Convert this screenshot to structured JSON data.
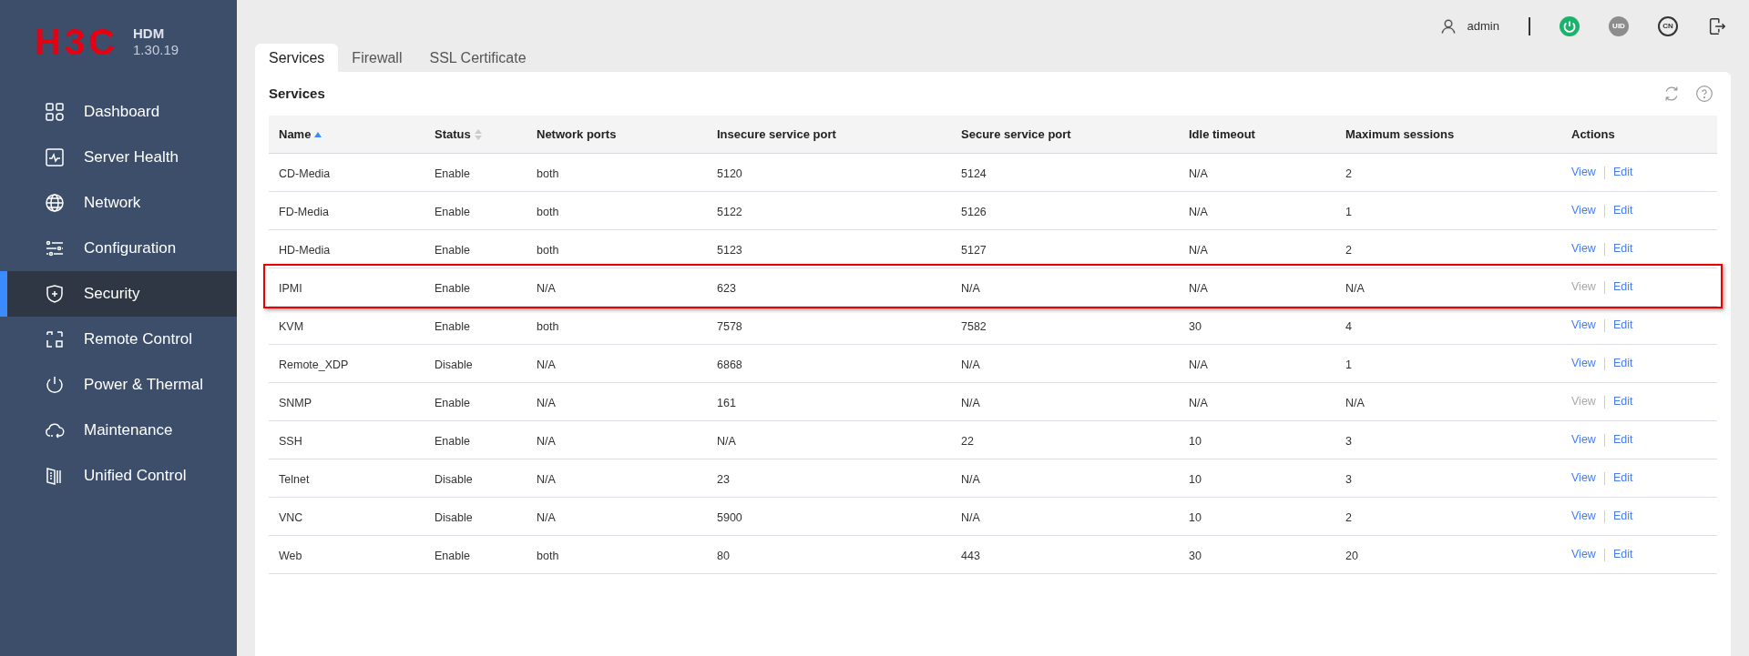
{
  "brand": {
    "logo": "H3C",
    "product": "HDM",
    "version": "1.30.19"
  },
  "sidebar": {
    "items": [
      {
        "label": "Dashboard",
        "kind": "grid",
        "selected": false
      },
      {
        "label": "Server Health",
        "kind": "pulse",
        "selected": false
      },
      {
        "label": "Network",
        "kind": "globe",
        "selected": false
      },
      {
        "label": "Configuration",
        "kind": "sliders",
        "selected": false
      },
      {
        "label": "Security",
        "kind": "shield",
        "selected": true
      },
      {
        "label": "Remote Control",
        "kind": "remote",
        "selected": false
      },
      {
        "label": "Power & Thermal",
        "kind": "power",
        "selected": false
      },
      {
        "label": "Maintenance",
        "kind": "cloud",
        "selected": false
      },
      {
        "label": "Unified Control",
        "kind": "panel",
        "selected": false
      }
    ]
  },
  "header": {
    "user": "admin",
    "uid": "UID",
    "language": "CN"
  },
  "tabs": [
    {
      "label": "Services",
      "selected": true
    },
    {
      "label": "Firewall",
      "selected": false
    },
    {
      "label": "SSL Certificate",
      "selected": false
    }
  ],
  "panel": {
    "title": "Services"
  },
  "table": {
    "columns": [
      {
        "label": "Name",
        "sorted": true
      },
      {
        "label": "Status",
        "sorted": false
      },
      {
        "label": "Network ports"
      },
      {
        "label": "Insecure service port"
      },
      {
        "label": "Secure service port"
      },
      {
        "label": "Idle timeout"
      },
      {
        "label": "Maximum sessions"
      },
      {
        "label": "Actions"
      }
    ],
    "rows": [
      {
        "cells": [
          "CD-Media",
          "Enable",
          "both",
          "5120",
          "5124",
          "N/A",
          "2"
        ],
        "view": "View",
        "edit": "Edit",
        "view_disabled": false,
        "highlighted": false
      },
      {
        "cells": [
          "FD-Media",
          "Enable",
          "both",
          "5122",
          "5126",
          "N/A",
          "1"
        ],
        "view": "View",
        "edit": "Edit",
        "view_disabled": false,
        "highlighted": false
      },
      {
        "cells": [
          "HD-Media",
          "Enable",
          "both",
          "5123",
          "5127",
          "N/A",
          "2"
        ],
        "view": "View",
        "edit": "Edit",
        "view_disabled": false,
        "highlighted": false
      },
      {
        "cells": [
          "IPMI",
          "Enable",
          "N/A",
          "623",
          "N/A",
          "N/A",
          "N/A"
        ],
        "view": "View",
        "edit": "Edit",
        "view_disabled": true,
        "highlighted": true
      },
      {
        "cells": [
          "KVM",
          "Enable",
          "both",
          "7578",
          "7582",
          "30",
          "4"
        ],
        "view": "View",
        "edit": "Edit",
        "view_disabled": false,
        "highlighted": false
      },
      {
        "cells": [
          "Remote_XDP",
          "Disable",
          "N/A",
          "6868",
          "N/A",
          "N/A",
          "1"
        ],
        "view": "View",
        "edit": "Edit",
        "view_disabled": false,
        "highlighted": false
      },
      {
        "cells": [
          "SNMP",
          "Enable",
          "N/A",
          "161",
          "N/A",
          "N/A",
          "N/A"
        ],
        "view": "View",
        "edit": "Edit",
        "view_disabled": true,
        "highlighted": false
      },
      {
        "cells": [
          "SSH",
          "Enable",
          "N/A",
          "N/A",
          "22",
          "10",
          "3"
        ],
        "view": "View",
        "edit": "Edit",
        "view_disabled": false,
        "highlighted": false
      },
      {
        "cells": [
          "Telnet",
          "Disable",
          "N/A",
          "23",
          "N/A",
          "10",
          "3"
        ],
        "view": "View",
        "edit": "Edit",
        "view_disabled": false,
        "highlighted": false
      },
      {
        "cells": [
          "VNC",
          "Disable",
          "N/A",
          "5900",
          "N/A",
          "10",
          "2"
        ],
        "view": "View",
        "edit": "Edit",
        "view_disabled": false,
        "highlighted": false
      },
      {
        "cells": [
          "Web",
          "Enable",
          "both",
          "80",
          "443",
          "30",
          "20"
        ],
        "view": "View",
        "edit": "Edit",
        "view_disabled": false,
        "highlighted": false
      }
    ]
  }
}
